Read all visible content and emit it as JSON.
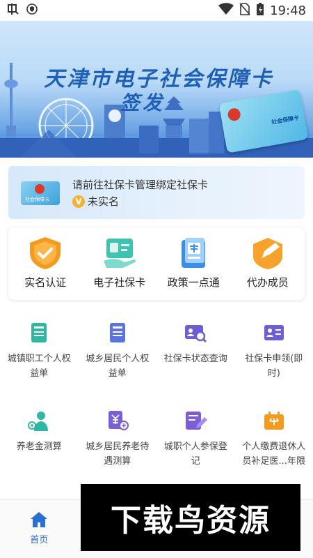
{
  "status_bar": {
    "time": "19:48",
    "icons": [
      "app-notification-icon",
      "shield-icon",
      "wifi-icon",
      "no-sim-icon",
      "battery-charging-icon"
    ]
  },
  "banner": {
    "title": "天津市电子社会保障卡",
    "subtitle": "签发",
    "card_label": "社会保障卡",
    "active_dot": 0,
    "dot_count": 2
  },
  "bind_card": {
    "prompt": "请前往社保卡管理绑定社保卡",
    "badge": "V",
    "status": "未实名",
    "card_label": "社会保障卡"
  },
  "quick_actions": [
    {
      "label": "实名认证",
      "icon": "verified-shield-icon"
    },
    {
      "label": "电子社保卡",
      "icon": "e-card-hand-icon"
    },
    {
      "label": "政策一点通",
      "icon": "policy-document-icon"
    },
    {
      "label": "代办成员",
      "icon": "pencil-edit-icon"
    }
  ],
  "services": [
    {
      "label": "城镇职工个人权益单",
      "icon": "urban-benefits-icon"
    },
    {
      "label": "城乡居民个人权益单",
      "icon": "rural-benefits-icon"
    },
    {
      "label": "社保卡状态查询",
      "icon": "card-status-search-icon"
    },
    {
      "label": "社保卡申领(即时)",
      "icon": "card-apply-icon"
    },
    {
      "label": "养老金测算",
      "icon": "pension-calc-icon"
    },
    {
      "label": "城乡居民养老待遇测算",
      "icon": "rural-pension-calc-icon"
    },
    {
      "label": "城职个人参保登记",
      "icon": "insurance-register-icon"
    },
    {
      "label": "个人缴费退休人员补足医...年限",
      "icon": "medical-supplement-icon"
    }
  ],
  "bottom_nav": {
    "home_label": "首页"
  },
  "watermark": "下载鸟资源",
  "colors": {
    "accent_blue": "#2a6fd6",
    "service_purple": "#6b5fd3",
    "quick_orange": "#f39a1f",
    "quick_teal": "#3fc2b0"
  }
}
